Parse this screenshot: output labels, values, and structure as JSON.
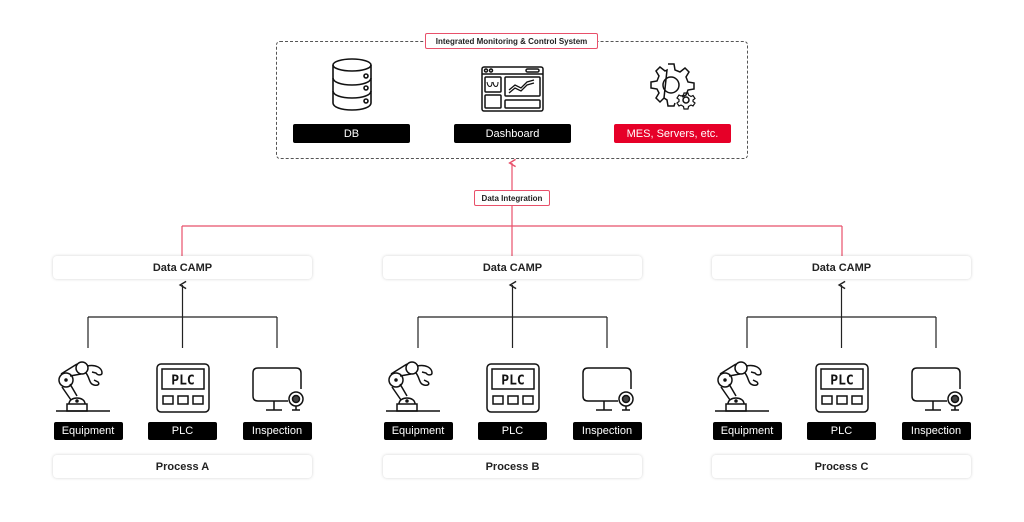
{
  "system": {
    "title": "Integrated Monitoring & Control System",
    "components": [
      {
        "label": "DB",
        "icon": "database-icon",
        "style": "black"
      },
      {
        "label": "Dashboard",
        "icon": "dashboard-icon",
        "style": "black"
      },
      {
        "label": "MES, Servers, etc.",
        "icon": "gear-icon",
        "style": "red"
      }
    ]
  },
  "integration_label": "Data Integration",
  "colors": {
    "accent": "#e60028",
    "line_red": "#e8506a",
    "label_bg": "#000000"
  },
  "processes": [
    {
      "camp_label": "Data CAMP",
      "name": "Process A",
      "devices": [
        {
          "label": "Equipment",
          "icon": "robot-arm-icon"
        },
        {
          "label": "PLC",
          "icon": "plc-icon",
          "icon_text": "PLC"
        },
        {
          "label": "Inspection",
          "icon": "camera-monitor-icon"
        }
      ]
    },
    {
      "camp_label": "Data CAMP",
      "name": "Process B",
      "devices": [
        {
          "label": "Equipment",
          "icon": "robot-arm-icon"
        },
        {
          "label": "PLC",
          "icon": "plc-icon",
          "icon_text": "PLC"
        },
        {
          "label": "Inspection",
          "icon": "camera-monitor-icon"
        }
      ]
    },
    {
      "camp_label": "Data CAMP",
      "name": "Process C",
      "devices": [
        {
          "label": "Equipment",
          "icon": "robot-arm-icon"
        },
        {
          "label": "PLC",
          "icon": "plc-icon",
          "icon_text": "PLC"
        },
        {
          "label": "Inspection",
          "icon": "camera-monitor-icon"
        }
      ]
    }
  ]
}
